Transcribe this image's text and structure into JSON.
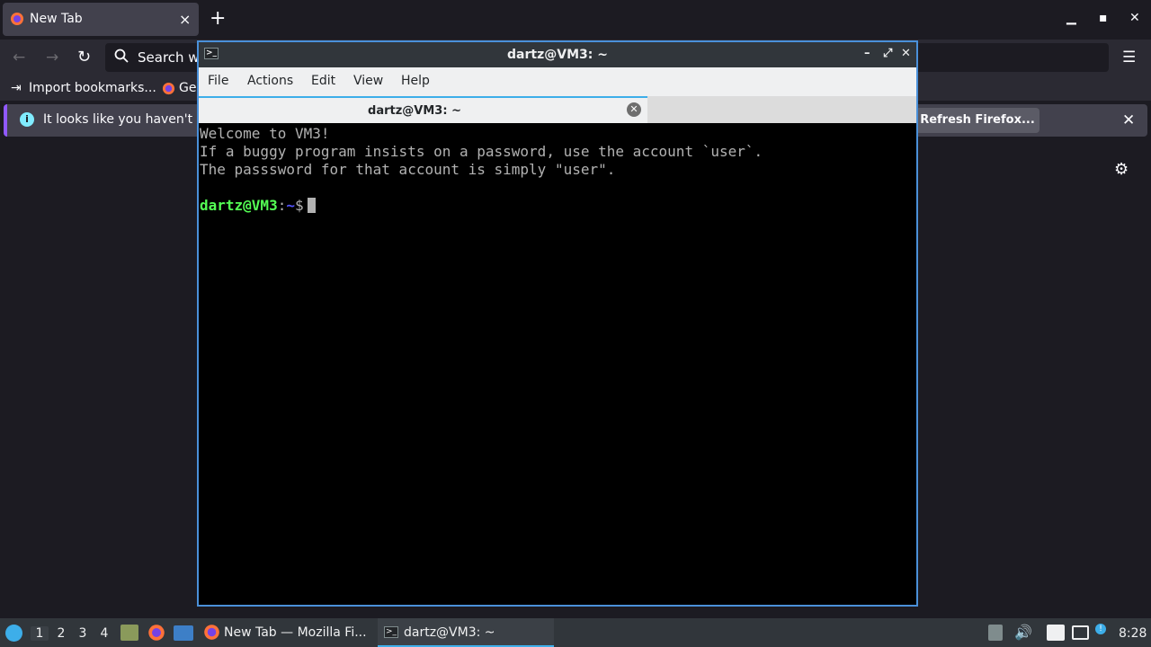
{
  "firefox": {
    "tab_title": "New Tab",
    "tab_close": "×",
    "new_tab": "+",
    "minimize": "▁",
    "maximize": "▪",
    "close": "✕",
    "url_placeholder": "Search w",
    "menu_icon": "☰",
    "bookmarks": [
      {
        "label": "Import bookmarks..."
      },
      {
        "label": "Ge"
      }
    ],
    "notification": {
      "text": "It looks like you haven't st",
      "button": "Refresh Firefox...",
      "close": "✕"
    }
  },
  "terminal": {
    "window_title": "dartz@VM3: ~",
    "menu": [
      "File",
      "Actions",
      "Edit",
      "View",
      "Help"
    ],
    "tab_title": "dartz@VM3: ~",
    "output_lines": [
      "Welcome to VM3!",
      "If a buggy program insists on a password, use the account `user`.",
      "The passsword for that account is simply \"user\"."
    ],
    "prompt_user": "dartz@VM3",
    "prompt_sep": ":",
    "prompt_path": "~",
    "prompt_symbol": "$"
  },
  "taskbar": {
    "workspaces": [
      "1",
      "2",
      "3",
      "4"
    ],
    "tasks": [
      {
        "label": "New Tab — Mozilla Fi..."
      },
      {
        "label": "dartz@VM3: ~"
      }
    ],
    "clock": "8:28"
  },
  "colors": {
    "accent": "#3daee9",
    "terminal_border": "#4a90d9",
    "prompt_user": "#54ff54",
    "prompt_path": "#5454ff",
    "firefox_notice_accent": "#9059ff"
  }
}
